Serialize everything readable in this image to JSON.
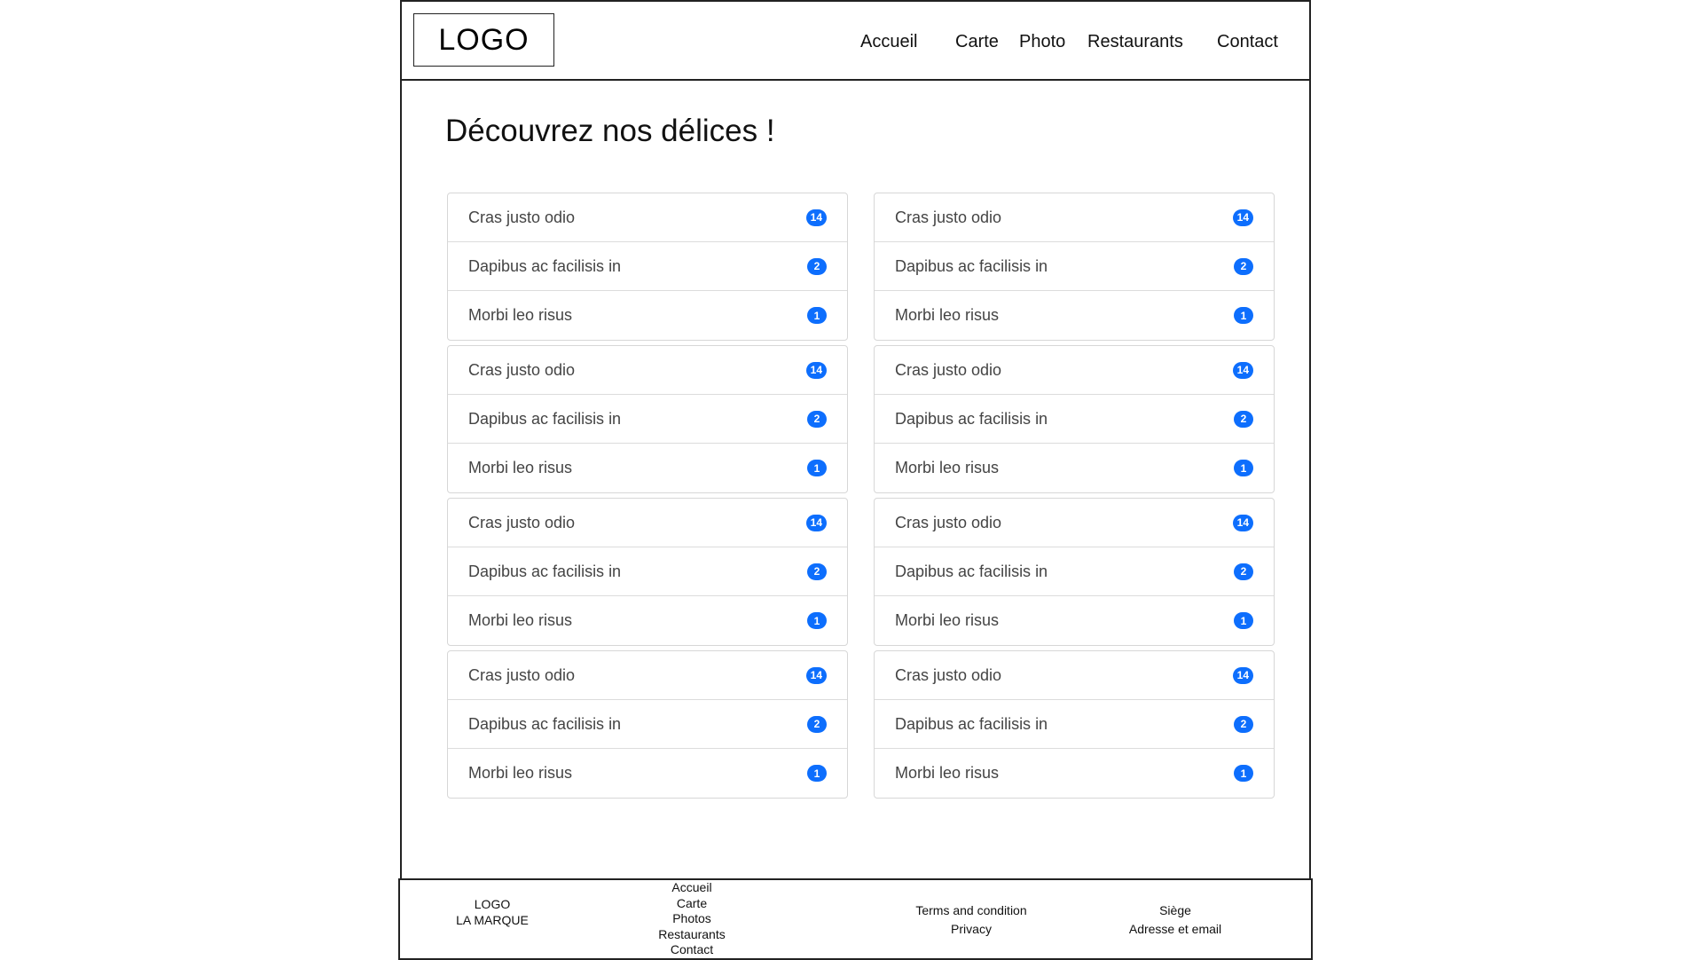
{
  "header": {
    "logo": "LOGO",
    "nav": [
      "Accueil",
      "Carte",
      "Photo",
      "Restaurants",
      "Contact"
    ]
  },
  "main": {
    "title": "Découvrez nos délices !",
    "groups": [
      {
        "items": [
          {
            "label": "Cras justo odio",
            "badge": "14"
          },
          {
            "label": "Dapibus ac facilisis in",
            "badge": "2"
          },
          {
            "label": "Morbi leo risus",
            "badge": "1"
          }
        ]
      },
      {
        "items": [
          {
            "label": "Cras justo odio",
            "badge": "14"
          },
          {
            "label": "Dapibus ac facilisis in",
            "badge": "2"
          },
          {
            "label": "Morbi leo risus",
            "badge": "1"
          }
        ]
      },
      {
        "items": [
          {
            "label": "Cras justo odio",
            "badge": "14"
          },
          {
            "label": "Dapibus ac facilisis in",
            "badge": "2"
          },
          {
            "label": "Morbi leo risus",
            "badge": "1"
          }
        ]
      },
      {
        "items": [
          {
            "label": "Cras justo odio",
            "badge": "14"
          },
          {
            "label": "Dapibus ac facilisis in",
            "badge": "2"
          },
          {
            "label": "Morbi leo risus",
            "badge": "1"
          }
        ]
      },
      {
        "items": [
          {
            "label": "Cras justo odio",
            "badge": "14"
          },
          {
            "label": "Dapibus ac facilisis in",
            "badge": "2"
          },
          {
            "label": "Morbi leo risus",
            "badge": "1"
          }
        ]
      },
      {
        "items": [
          {
            "label": "Cras justo odio",
            "badge": "14"
          },
          {
            "label": "Dapibus ac facilisis in",
            "badge": "2"
          },
          {
            "label": "Morbi leo risus",
            "badge": "1"
          }
        ]
      },
      {
        "items": [
          {
            "label": "Cras justo odio",
            "badge": "14"
          },
          {
            "label": "Dapibus ac facilisis in",
            "badge": "2"
          },
          {
            "label": "Morbi leo risus",
            "badge": "1"
          }
        ]
      },
      {
        "items": [
          {
            "label": "Cras justo odio",
            "badge": "14"
          },
          {
            "label": "Dapibus ac facilisis in",
            "badge": "2"
          },
          {
            "label": "Morbi leo risus",
            "badge": "1"
          }
        ]
      }
    ],
    "badge_color": "#0d6efd"
  },
  "footer": {
    "brand": [
      "LOGO",
      "LA MARQUE"
    ],
    "nav": [
      "Accueil",
      "Carte",
      "Photos",
      "Restaurants",
      "Contact"
    ],
    "legal": [
      "Terms and condition",
      "Privacy"
    ],
    "contact": [
      "Siège",
      "Adresse et email"
    ]
  }
}
